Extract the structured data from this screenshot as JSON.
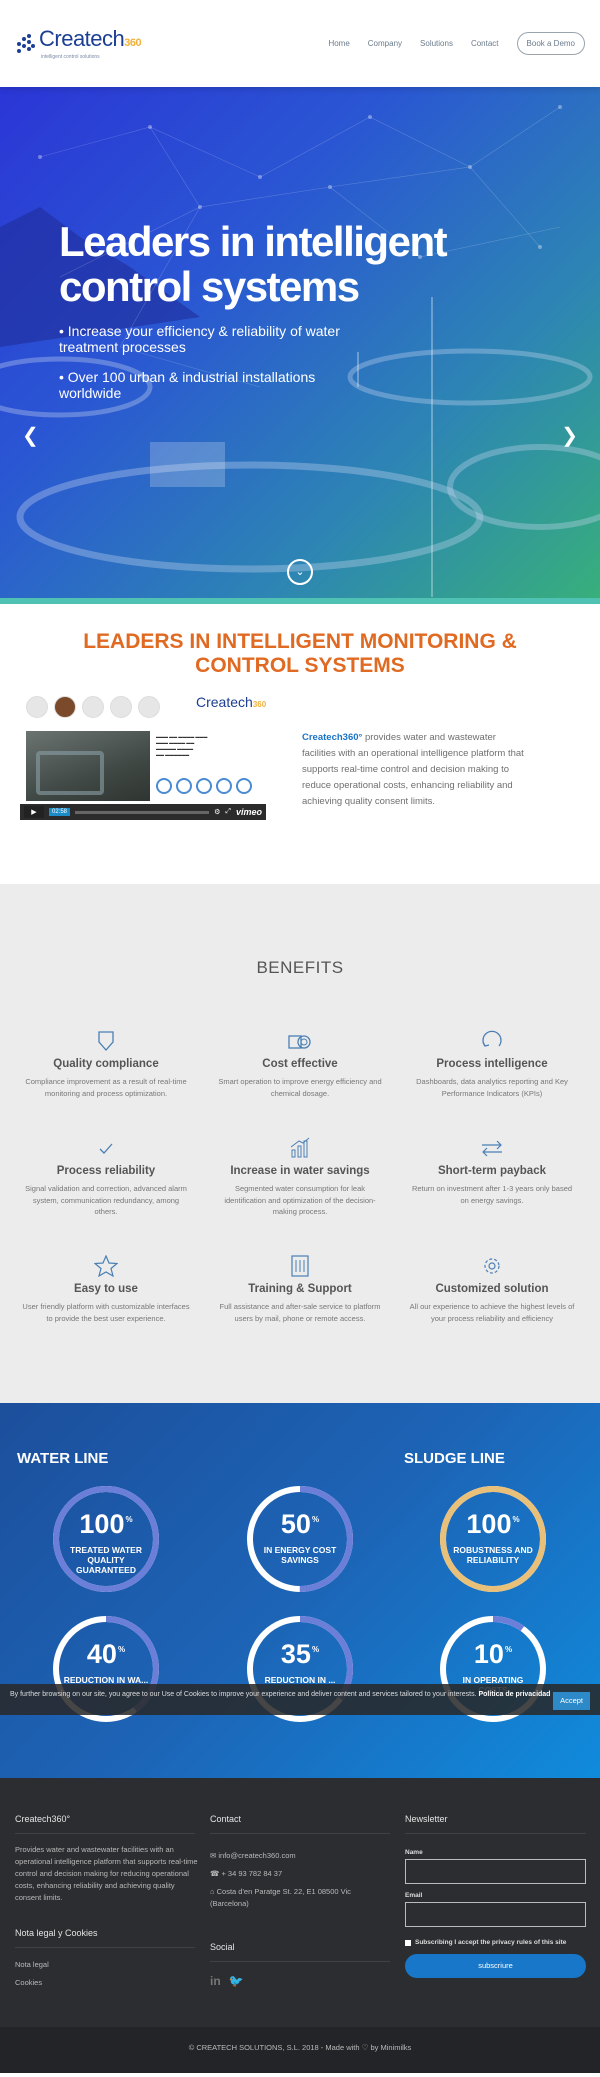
{
  "header": {
    "logo_name": "Createch",
    "logo_suffix": "360",
    "logo_tagline": "intelligent control solutions",
    "nav": [
      "Home",
      "Company",
      "Solutions",
      "Contact"
    ],
    "cta": "Book a Demo"
  },
  "hero": {
    "title_line1": "Leaders in intelligent",
    "title_line2": "control systems",
    "bullets": [
      "• Increase your efficiency & reliability of water treatment processes",
      "• Over 100 urban & industrial installations worldwide"
    ]
  },
  "leaders": {
    "title": "LEADERS IN INTELLIGENT MONITORING & CONTROL SYSTEMS",
    "brand": "Createch360°",
    "text": " provides water and wastewater facilities with an operational intelligence platform that supports real-time control and decision making to reduce operational costs, enhancing reliability and achieving quality consent limits.",
    "video_time": "02:58",
    "video_brand": "vimeo"
  },
  "benefits": {
    "title": "BENEFITS",
    "items": [
      {
        "icon": "shield-icon",
        "title": "Quality compliance",
        "desc": "Compliance improvement as a result of real-time monitoring and process optimization."
      },
      {
        "icon": "coins-icon",
        "title": "Cost effective",
        "desc": "Smart operation to improve energy efficiency and chemical dosage."
      },
      {
        "icon": "refresh-icon",
        "title": "Process intelligence",
        "desc": "Dashboards, data analytics reporting and Key Performance Indicators (KPIs)"
      },
      {
        "icon": "check-icon",
        "title": "Process reliability",
        "desc": "Signal validation and correction, advanced alarm system, communication redundancy, among others."
      },
      {
        "icon": "bar-chart-icon",
        "title": "Increase in water savings",
        "desc": "Segmented water consumption for leak identification and optimization of the decision-making process."
      },
      {
        "icon": "exchange-icon",
        "title": "Short-term payback",
        "desc": "Return on investment after 1-3 years only based on energy savings."
      },
      {
        "icon": "star-icon",
        "title": "Easy to use",
        "desc": "User friendly platform with customizable interfaces to provide the best user experience."
      },
      {
        "icon": "book-icon",
        "title": "Training & Support",
        "desc": "Full assistance and after-sale service to platform users by mail, phone or remote access."
      },
      {
        "icon": "gear-icon",
        "title": "Customized solution",
        "desc": "All our experience to achieve the highest levels of your process reliability and efficiency"
      }
    ]
  },
  "stats": {
    "water_title": "WATER LINE",
    "sludge_title": "SLUDGE LINE",
    "gauges": [
      {
        "value": "100",
        "unit": "%",
        "label": "TREATED WATER QUALITY GUARANTEED",
        "fraction": 1.0,
        "color": "#6b7fd8"
      },
      {
        "value": "50",
        "unit": "%",
        "label": "IN ENERGY COST SAVINGS",
        "fraction": 0.5,
        "color": "#6b7fd8"
      },
      {
        "value": "100",
        "unit": "%",
        "label": "ROBUSTNESS AND RELIABILITY",
        "fraction": 1.0,
        "color": "#e8c07a"
      },
      {
        "value": "40",
        "unit": "%",
        "label": "REDUCTION IN WA...",
        "fraction": 0.4,
        "color": "#6b7fd8"
      },
      {
        "value": "35",
        "unit": "%",
        "label": "REDUCTION IN ...",
        "fraction": 0.35,
        "color": "#6b7fd8"
      },
      {
        "value": "10",
        "unit": "%",
        "label": "IN OPERATING COSTS",
        "fraction": 0.1,
        "color": "#6b7fd8"
      }
    ],
    "cookie_text": "By further browsing on our site, you agree to our Use of Cookies to improve your experience and deliver content and services tailored to your interests.",
    "cookie_link": "Política de privacidad",
    "cookie_accept": "Accept"
  },
  "footer": {
    "about_title": "Createch360°",
    "about_text": "Provides water and wastewater facilities with an operational intelligence platform that supports real-time control and decision making for reducing operational costs, enhancing reliability and achieving quality consent limits.",
    "legal_title": "Nota legal y Cookies",
    "legal_links": [
      "Nota legal",
      "Cookies"
    ],
    "contact_title": "Contact",
    "email": "info@createch360.com",
    "phone": "+ 34 93 782 84 37",
    "address": "Costa d'en Paratge St. 22, E1 08500 Vic (Barcelona)",
    "social_title": "Social",
    "newsletter_title": "Newsletter",
    "name_label": "Name",
    "email_label": "Email",
    "privacy_check": "Subscribing I accept the privacy rules of this site",
    "subscribe": "subscriure",
    "copyright": "© CREATECH SOLUTIONS, S.L. 2018 - Made with ♡ by Minimilks"
  }
}
